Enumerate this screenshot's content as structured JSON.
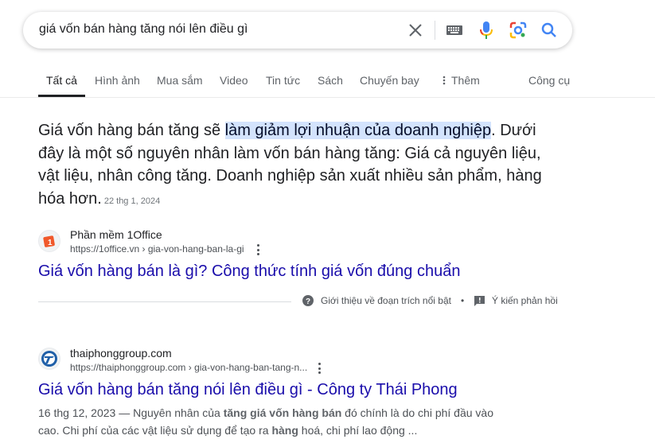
{
  "search": {
    "query": "giá vốn bán hàng tăng nói lên điều gì",
    "icons": [
      "clear-icon",
      "keyboard-icon",
      "microphone-icon",
      "lens-icon",
      "search-icon"
    ]
  },
  "tabs": [
    {
      "label": "Tất cả",
      "active": true
    },
    {
      "label": "Hình ảnh"
    },
    {
      "label": "Mua sắm"
    },
    {
      "label": "Video"
    },
    {
      "label": "Tin tức"
    },
    {
      "label": "Sách"
    },
    {
      "label": "Chuyến bay"
    },
    {
      "label": "Thêm"
    },
    {
      "label": "Công cụ"
    }
  ],
  "featured_snippet": {
    "text_before": "Giá vốn hàng bán tăng sẽ ",
    "highlight": "làm giảm lợi nhuận của doanh nghiệp",
    "text_after": ". Dưới đây là một số nguyên nhân làm vốn bán hàng tăng: Giá cả nguyên liệu, vật liệu, nhân công tăng. Doanh nghiệp sản xuất nhiều sản phẩm, hàng hóa hơn.",
    "date": "22 thg 1, 2024",
    "footer": {
      "about_label": "Giới thiệu về đoạn trích nổi bật",
      "separator": "•",
      "feedback_label": "Ý kiến phản hồi"
    }
  },
  "results": [
    {
      "site_name": "Phần mềm 1Office",
      "url": "https://1office.vn › gia-von-hang-ban-la-gi",
      "title": "Giá vốn hàng bán là gì? Công thức tính giá vốn đúng chuẩn"
    },
    {
      "site_name": "thaiphonggroup.com",
      "url": "https://thaiphonggroup.com › gia-von-hang-ban-tang-n...",
      "title": "Giá vốn hàng bán tăng nói lên điều gì - Công ty Thái Phong",
      "desc_date": "16 thg 12, 2023 — ",
      "desc_1": "Nguyên nhân của ",
      "desc_bold_1": "tăng giá vốn hàng bán",
      "desc_2": " đó chính là do chi phí đầu vào cao. Chi phí của các vật liệu sử dụng để tạo ra ",
      "desc_bold_2": "hàng",
      "desc_3": " hoá, chi phí lao động ..."
    }
  ],
  "colors": {
    "link": "#1a0dab",
    "highlight_bg": "#d3e3fd",
    "search_icon": "#4285f4"
  }
}
